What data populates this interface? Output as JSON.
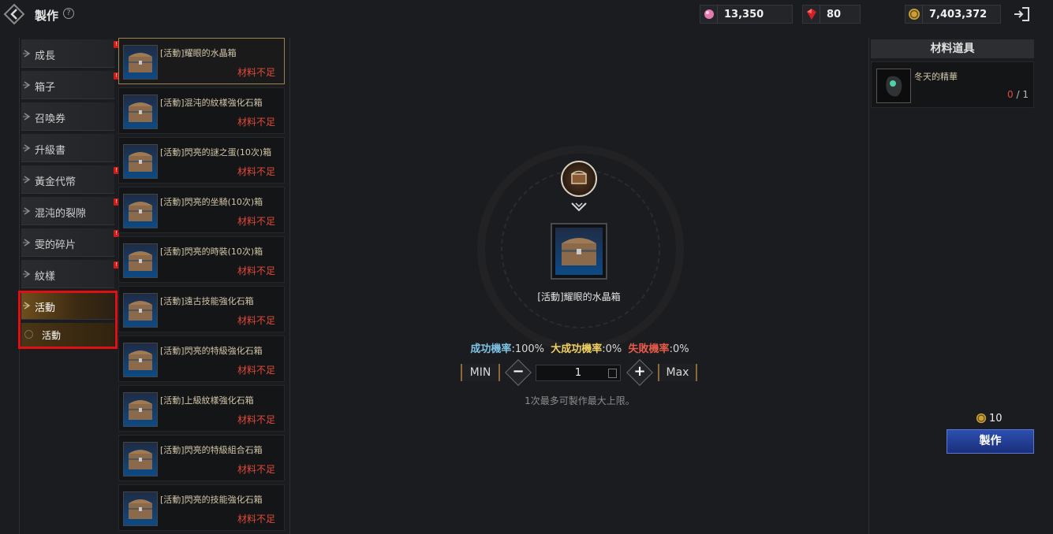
{
  "header": {
    "title": "製作",
    "help": "?",
    "currencies": [
      {
        "icon": "pink-crystal-icon",
        "value": "13,350"
      },
      {
        "icon": "red-ruby-icon",
        "value": "80"
      },
      {
        "icon": "gold-coin-icon",
        "value": "7,403,372"
      }
    ]
  },
  "categories": [
    {
      "label": "成長",
      "badge": true
    },
    {
      "label": "箱子",
      "badge": true
    },
    {
      "label": "召喚券",
      "badge": false
    },
    {
      "label": "升級書",
      "badge": false
    },
    {
      "label": "黃金代幣",
      "badge": true
    },
    {
      "label": "混沌的裂隙",
      "badge": true
    },
    {
      "label": "雯的碎片",
      "badge": true
    },
    {
      "label": "紋樣",
      "badge": true
    },
    {
      "label": "活動",
      "badge": false,
      "active": true
    }
  ],
  "sub_category": {
    "label": "活動"
  },
  "recipes": [
    {
      "name": "[活動]耀眼的水晶箱",
      "status": "材料不足",
      "selected": true
    },
    {
      "name": "[活動]混沌的紋樣強化石箱",
      "status": "材料不足"
    },
    {
      "name": "[活動]閃亮的謎之蛋(10次)箱",
      "status": "材料不足"
    },
    {
      "name": "[活動]閃亮的坐騎(10次)箱",
      "status": "材料不足"
    },
    {
      "name": "[活動]閃亮的時裝(10次)箱",
      "status": "材料不足"
    },
    {
      "name": "[活動]遠古技能強化石箱",
      "status": "材料不足"
    },
    {
      "name": "[活動]閃亮的特級強化石箱",
      "status": "材料不足"
    },
    {
      "name": "[活動]上級紋樣強化石箱",
      "status": "材料不足"
    },
    {
      "name": "[活動]閃亮的特級組合石箱",
      "status": "材料不足"
    },
    {
      "name": "[活動]閃亮的技能強化石箱",
      "status": "材料不足"
    }
  ],
  "selected_item": {
    "name": "[活動]耀眼的水晶箱",
    "rates": {
      "success_label": "成功機率",
      "success_value": ":100%",
      "great_label": "大成功機率",
      "great_value": ":0%",
      "fail_label": "失敗機率",
      "fail_value": ":0%"
    },
    "min_label": "MIN",
    "max_label": "Max",
    "quantity": "1",
    "limit_note": "1次最多可製作最大上限。"
  },
  "materials": {
    "header": "材料道具",
    "items": [
      {
        "name": "冬天的精華",
        "have": "0",
        "sep": " / ",
        "need": "1"
      }
    ]
  },
  "craft": {
    "cost": "10",
    "button_label": "製作"
  },
  "colors": {
    "accent_red": "#e24a3a",
    "craft_blue": "#2d4fb0",
    "selected_gold": "#9b8350"
  }
}
